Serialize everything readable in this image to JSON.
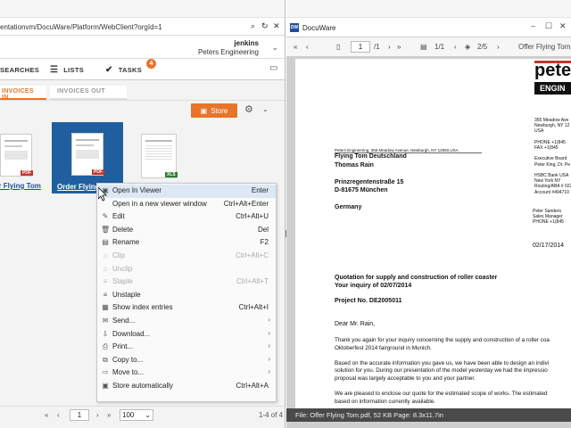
{
  "browser": {
    "url": "entationvm/DocuWare/Platform/WebClient?orgId=1",
    "url_controls": [
      "search-icon",
      "refresh-icon",
      "close-icon"
    ]
  },
  "user": {
    "name": "jenkins",
    "org": "Peters Engineering"
  },
  "nav": {
    "searches": "SEARCHES",
    "lists": "LISTS",
    "tasks": "TASKS",
    "tasks_badge": "4"
  },
  "tabs": [
    {
      "label": "INVOICES IN",
      "active": true
    },
    {
      "label": "INVOICES OUT",
      "active": false
    }
  ],
  "toolbar": {
    "store_label": "Store"
  },
  "documents": [
    {
      "label": "er Flying Tom",
      "type": "PDF"
    },
    {
      "label": "Order Flying",
      "type": "PDF",
      "selected": true
    },
    {
      "label": "",
      "type": "XLS"
    }
  ],
  "context_menu": [
    {
      "label": "Open In Viewer",
      "shortcut": "Enter",
      "icon": "viewer-icon",
      "enabled": true,
      "highlight": true
    },
    {
      "label": "Open in a new viewer window",
      "shortcut": "Ctrl+Alt+Enter",
      "icon": "",
      "enabled": true
    },
    {
      "label": "Edit",
      "shortcut": "Ctrl+Alt+U",
      "icon": "pencil-icon",
      "enabled": true
    },
    {
      "label": "Delete",
      "shortcut": "Del",
      "icon": "trash-icon",
      "enabled": true
    },
    {
      "label": "Rename",
      "shortcut": "F2",
      "icon": "rename-icon",
      "enabled": true
    },
    {
      "label": "Clip",
      "shortcut": "Ctrl+Alt+C",
      "icon": "clip-icon",
      "enabled": false
    },
    {
      "label": "Unclip",
      "shortcut": "",
      "icon": "unclip-icon",
      "enabled": false
    },
    {
      "label": "Staple",
      "shortcut": "Ctrl+Alt+T",
      "icon": "staple-icon",
      "enabled": false
    },
    {
      "label": "Unstaple",
      "shortcut": "",
      "icon": "unstaple-icon",
      "enabled": true
    },
    {
      "label": "Show index entries",
      "shortcut": "Ctrl+Alt+I",
      "icon": "index-icon",
      "enabled": true
    },
    {
      "label": "Send...",
      "shortcut": "",
      "icon": "mail-icon",
      "enabled": true,
      "submenu": true
    },
    {
      "label": "Download...",
      "shortcut": "",
      "icon": "download-icon",
      "enabled": true,
      "submenu": true
    },
    {
      "label": "Print...",
      "shortcut": "",
      "icon": "print-icon",
      "enabled": true,
      "submenu": true
    },
    {
      "label": "Copy to...",
      "shortcut": "",
      "icon": "copy-icon",
      "enabled": true,
      "submenu": true
    },
    {
      "label": "Move to...",
      "shortcut": "",
      "icon": "move-icon",
      "enabled": true,
      "submenu": true
    },
    {
      "label": "Store automatically",
      "shortcut": "Ctrl+Alt+A",
      "icon": "store-icon",
      "enabled": true
    }
  ],
  "pager": {
    "page": "1",
    "page_size": "100",
    "count": "1-4 of 4"
  },
  "viewer": {
    "title": "DocuWare",
    "logo_text": "DW",
    "page_current": "1",
    "page_total": "/1",
    "doc_pages": "1/1",
    "layer_pages": "2/5",
    "filename": "Offer Flying Tom",
    "status": "File: Offer Flying Tom.pdf, 52 KB Page: 8.3x11.7in"
  },
  "letter": {
    "brand_top": "pete",
    "brand_bottom": "ENGIN",
    "address_lines": [
      "355 Meadow Ave",
      "Newburgh, NY 12",
      "USA",
      "",
      "PHONE  +1(845",
      "FAX      +1(845",
      "",
      "Executive Board",
      "Peter King, Dr. Pe",
      "",
      "HSBC Bank USA",
      "New York NY",
      "Routing/ABA # 022",
      "Account #494710"
    ],
    "sender_line": "Peters Engineering, 355 Meadow Avenue, Newburgh, NY 12550,USA",
    "recipient": [
      "Flying Tom Deutschland",
      "Thomas Rain",
      "",
      "Prinzregentenstraße 15",
      "D-81675 München",
      "",
      "Germany"
    ],
    "contact": [
      "Peter Sanders",
      "Sales Manager",
      "PHONE  +1(845"
    ],
    "date": "02/17/2014",
    "subject1": "Quotation for supply and construction of roller coaster",
    "subject2": "Your inquiry of 02/07/2014",
    "project": "Project No. DE2005011",
    "salutation": "Dear Mr. Rain,",
    "body": [
      "Thank you again for your inquiry concerning the supply and construction of a roller coa",
      "Oktoberfest 2014 fairground in Munich.",
      "",
      "Based on the accurate information you gave us, we have been able to design an indivi",
      "solution for you. During our presentation of the model yesterday we had the impressio",
      "proposal was largely acceptable to you and your partner.",
      "",
      "We are pleased to enclose our quote for the estimated scope of works. The estimated",
      "based on information currently available."
    ]
  },
  "colors": {
    "accent": "#e8742a",
    "selection": "#1f5fa0",
    "link": "#1f4e9d"
  }
}
